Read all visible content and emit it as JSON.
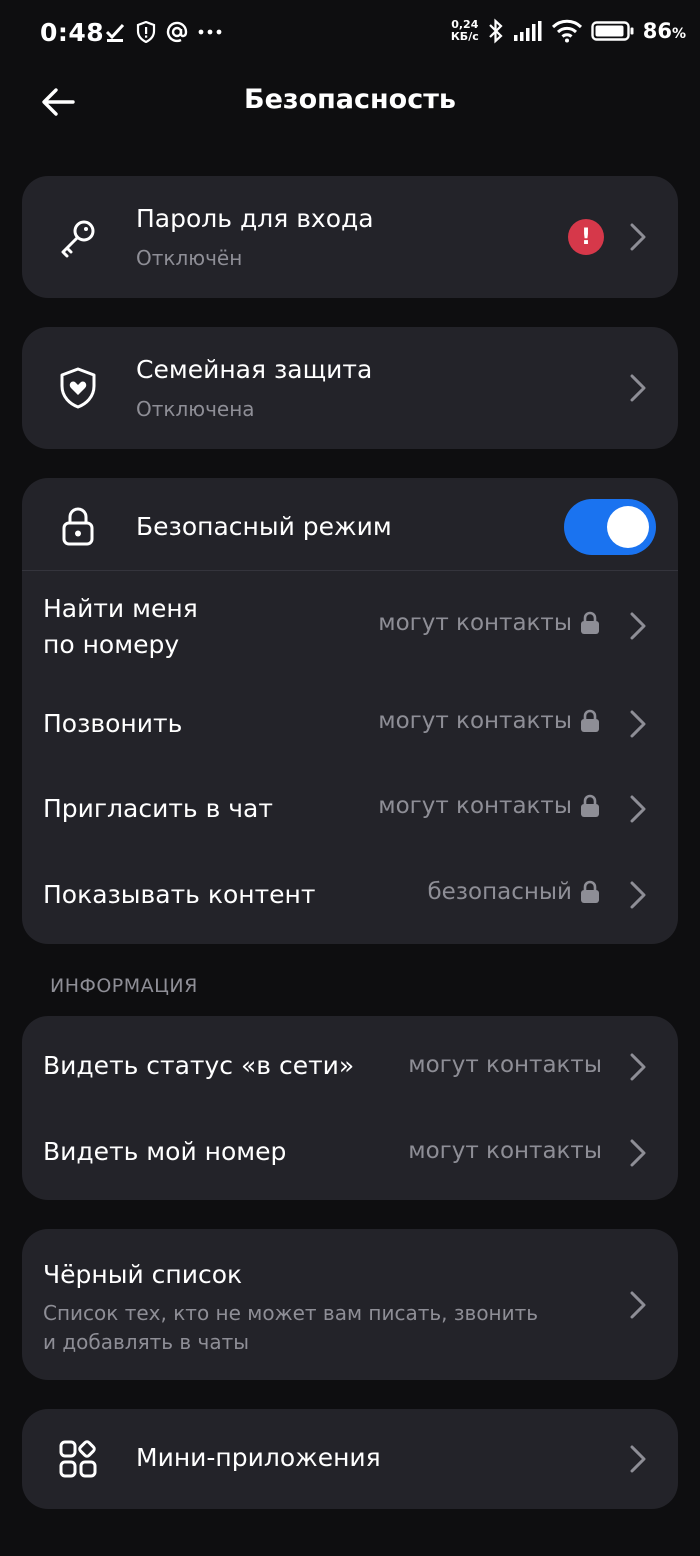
{
  "status_bar": {
    "time": "0:48",
    "speed_value": "0,24",
    "speed_unit": "КБ/с",
    "battery_percent": "86",
    "battery_sign": "%"
  },
  "header": {
    "title": "Безопасность"
  },
  "login_password": {
    "title": "Пароль для входа",
    "subtitle": "Отключён",
    "alert": "!"
  },
  "family_protection": {
    "title": "Семейная защита",
    "subtitle": "Отключена"
  },
  "safe_mode": {
    "title": "Безопасный режим",
    "enabled": true,
    "rows": [
      {
        "label_line1": "Найти меня",
        "label_line2": "по номеру",
        "value": "могут контакты"
      },
      {
        "label": "Позвонить",
        "value": "могут контакты"
      },
      {
        "label": "Пригласить в чат",
        "value": "могут контакты"
      },
      {
        "label": "Показывать контент",
        "value": "безопасный"
      }
    ]
  },
  "information": {
    "section_title": "ИНФОРМАЦИЯ",
    "rows": [
      {
        "label": "Видеть статус «в сети»",
        "value": "могут контакты"
      },
      {
        "label": "Видеть мой номер",
        "value": "могут контакты"
      }
    ]
  },
  "blacklist": {
    "title": "Чёрный список",
    "subtitle_line1": "Список тех, кто не может вам писать, звонить",
    "subtitle_line2": "и добавлять в чаты"
  },
  "mini_apps": {
    "title": "Мини-приложения"
  },
  "colors": {
    "background": "#0e0e10",
    "card": "#232329",
    "accent": "#1a73f0",
    "alert": "#d6384a",
    "secondary_text": "#8e8e96"
  }
}
